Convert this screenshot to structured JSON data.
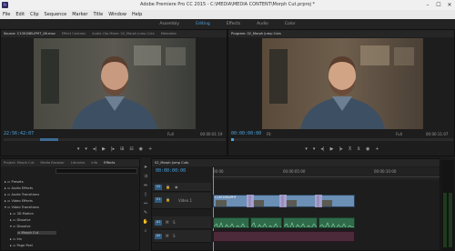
{
  "window": {
    "title": "Adobe Premiere Pro CC 2015 - C:\\MEDIA\\MEDIA CONTENT\\Morph Cut.prproj *",
    "app_icon": "Pr"
  },
  "menu": [
    "File",
    "Edit",
    "Clip",
    "Sequence",
    "Marker",
    "Title",
    "Window",
    "Help"
  ],
  "workspaces": {
    "items": [
      "Assembly",
      "Editing",
      "Effects",
      "Audio",
      "Color"
    ],
    "active": "Editing"
  },
  "source_monitor": {
    "tabs": [
      "Source: C1301NELIPHT_06.mov",
      "Effect Controls",
      "Audio Clip Mixer: 02_Morph Jump Cuts",
      "Metadata"
    ],
    "timecode_in": "22:56:42:07",
    "fit": "Full",
    "duration": "00:00:01:19"
  },
  "program_monitor": {
    "tab": "Program: 02_Morph Jump Cuts",
    "timecode": "00:00:00:00",
    "fit": "Fit",
    "quality": "Full",
    "duration": "00:00:11:07"
  },
  "project_panel": {
    "tabs": [
      "Project: Morph Cut",
      "Media Browser",
      "Libraries",
      "Info",
      "Effects"
    ],
    "tree": [
      "Presets",
      "Audio Effects",
      "Audio Transitions",
      "Video Effects",
      "Video Transitions",
      "3D Motion",
      "Dissolve",
      "Dissolve",
      "Morph Cut",
      "Iris",
      "Page Peel"
    ]
  },
  "timeline": {
    "tab": "02_Morph Jump Cuts",
    "timecode": "00:00:00:00",
    "ruler": [
      "00:00",
      "00:00:05:00",
      "00:00:10:00"
    ],
    "tracks": [
      {
        "name": "V2",
        "label": ""
      },
      {
        "name": "V1",
        "label": "Video 1"
      },
      {
        "name": "A1",
        "label": ""
      },
      {
        "name": "A2",
        "label": ""
      }
    ],
    "clip_label": "C1301NELIPHT"
  },
  "colors": {
    "accent": "#4aa3df",
    "video_clip": "#6b8fb5",
    "audio_clip": "#2f6a4a"
  }
}
